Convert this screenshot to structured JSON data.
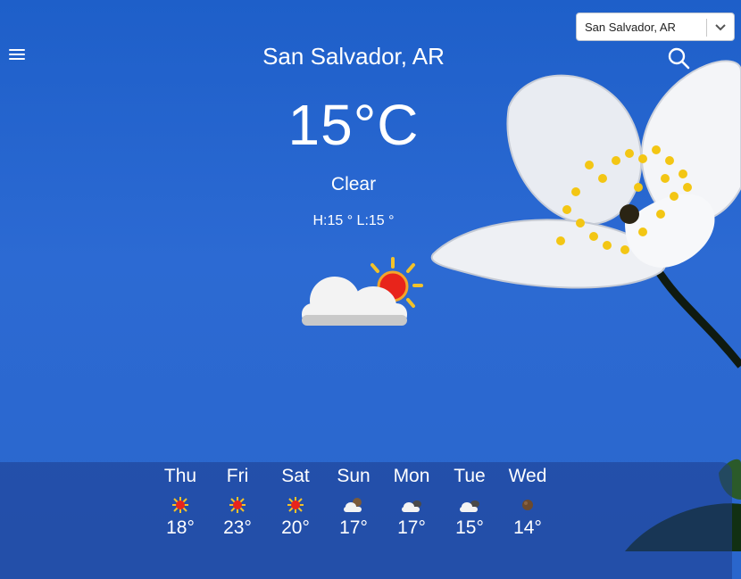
{
  "header": {
    "city": "San Salvador, AR",
    "menu_icon": "hamburger-menu-icon",
    "search_icon": "search-icon"
  },
  "location_select": {
    "value": "San Salvador, AR",
    "chevron_icon": "chevron-down-icon"
  },
  "current": {
    "temperature": "15°C",
    "condition": "Clear",
    "hilo": "H:15 ° L:15 °",
    "icon": "partly-cloudy-icon"
  },
  "forecast": [
    {
      "day": "Thu",
      "temp": "18°",
      "icon": "sun-icon"
    },
    {
      "day": "Fri",
      "temp": "23°",
      "icon": "sun-icon"
    },
    {
      "day": "Sat",
      "temp": "20°",
      "icon": "sun-icon"
    },
    {
      "day": "Sun",
      "temp": "17°",
      "icon": "partly-cloudy-icon"
    },
    {
      "day": "Mon",
      "temp": "17°",
      "icon": "cloudy-icon"
    },
    {
      "day": "Tue",
      "temp": "15°",
      "icon": "cloudy-icon"
    },
    {
      "day": "Wed",
      "temp": "14°",
      "icon": "moon-icon"
    }
  ],
  "colors": {
    "background": "#2a66cc",
    "sun": "#e8241b",
    "sun_rays": "#f2c22a"
  }
}
